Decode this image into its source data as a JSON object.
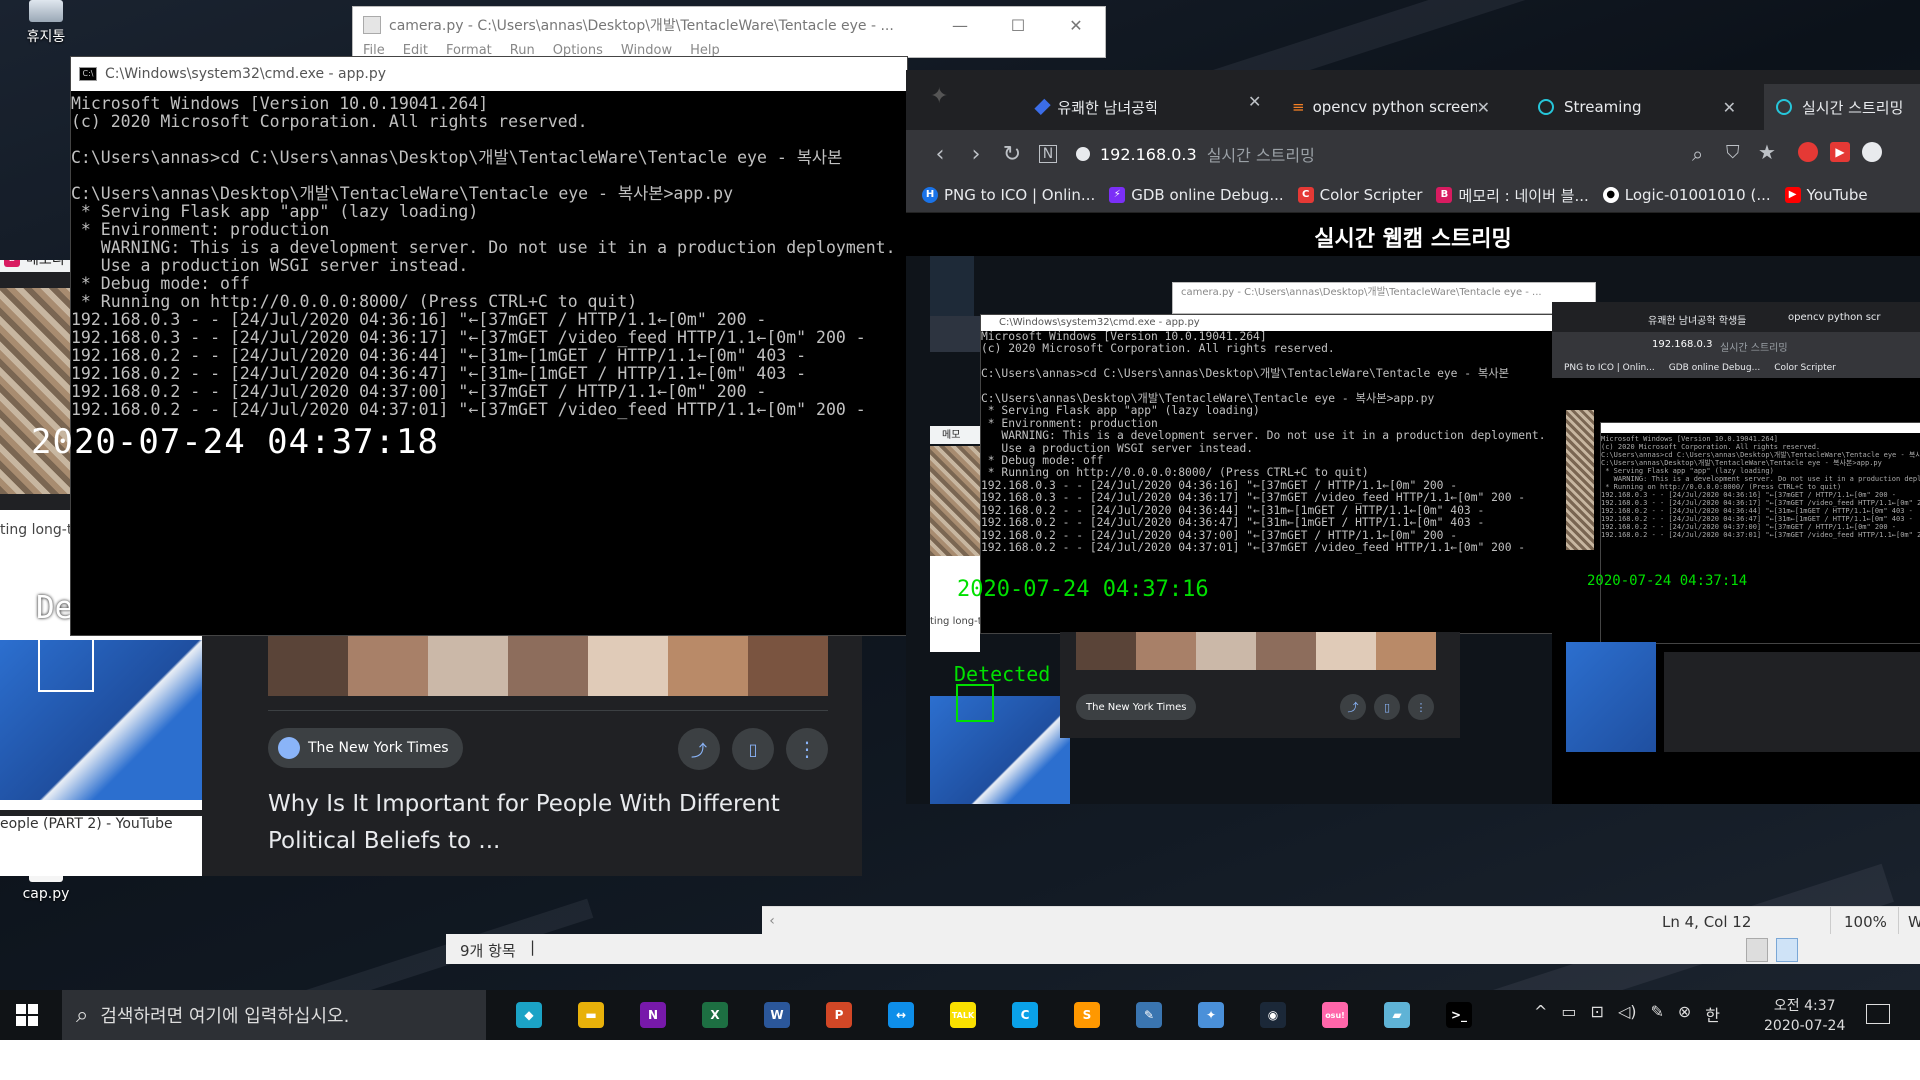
{
  "desktop": {
    "icons": [
      {
        "label": "휴지통"
      },
      {
        "label": "cap.py"
      }
    ]
  },
  "editor": {
    "title": "camera.py - C:\\Users\\annas\\Desktop\\개발\\TentacleWare\\Tentacle eye - ...",
    "menu": [
      "File",
      "Edit",
      "Format",
      "Run",
      "Options",
      "Window",
      "Help"
    ]
  },
  "cmd": {
    "title": "C:\\Windows\\system32\\cmd.exe - app.py",
    "lines": [
      "Microsoft Windows [Version 10.0.19041.264]",
      "(c) 2020 Microsoft Corporation. All rights reserved.",
      "",
      "C:\\Users\\annas>cd C:\\Users\\annas\\Desktop\\개발\\TentacleWare\\Tentacle eye - 복사본",
      "",
      "C:\\Users\\annas\\Desktop\\개발\\TentacleWare\\Tentacle eye - 복사본>app.py",
      " * Serving Flask app \"app\" (lazy loading)",
      " * Environment: production",
      "   WARNING: This is a development server. Do not use it in a production deployment.",
      "   Use a production WSGI server instead.",
      " * Debug mode: off",
      " * Running on http://0.0.0.0:8000/ (Press CTRL+C to quit)",
      "192.168.0.3 - - [24/Jul/2020 04:36:16] \"←[37mGET / HTTP/1.1←[0m\" 200 -",
      "192.168.0.3 - - [24/Jul/2020 04:36:17] \"←[37mGET /video_feed HTTP/1.1←[0m\" 200 -",
      "192.168.0.2 - - [24/Jul/2020 04:36:44] \"←[31m←[1mGET / HTTP/1.1←[0m\" 403 -",
      "192.168.0.2 - - [24/Jul/2020 04:36:47] \"←[31m←[1mGET / HTTP/1.1←[0m\" 403 -",
      "192.168.0.2 - - [24/Jul/2020 04:37:00] \"←[37mGET / HTTP/1.1←[0m\" 200 -",
      "192.168.0.2 - - [24/Jul/2020 04:37:01] \"←[37mGET /video_feed HTTP/1.1←[0m\" 200 -"
    ],
    "overlay_timestamp": "2020-07-24 04:37:18"
  },
  "bgbrowser": {
    "bookmark_label": "메모리",
    "caption_1": "ting long-t",
    "detected_label": "Detected",
    "caption_2": "eople (PART 2) - YouTube",
    "news_source": "The New York Times",
    "headline": "Why Is It Important for People With Different Political Beliefs to ..."
  },
  "chrome": {
    "tabs": [
      {
        "label": "유쾌한 남녀공학 학생들"
      },
      {
        "label": "opencv python screen c"
      },
      {
        "label": "Streaming"
      },
      {
        "label": "실시간 스트리밍"
      }
    ],
    "address": "192.168.0.3",
    "address_title": "실시간 스트리밍",
    "bookmarks": [
      {
        "label": "PNG to ICO | Onlin...",
        "color": "#1a73e8",
        "glyph": "H"
      },
      {
        "label": "GDB online Debug...",
        "color": "#7b2ff7",
        "glyph": "⚡"
      },
      {
        "label": "Color Scripter",
        "color": "#e53935",
        "glyph": "C"
      },
      {
        "label": "메모리 : 네이버 블...",
        "color": "#d81b60",
        "glyph": "B"
      },
      {
        "label": "Logic-01001010 (...",
        "color": "#24292e",
        "glyph": "●"
      },
      {
        "label": "YouTube",
        "color": "#ff0000",
        "glyph": "▶"
      }
    ],
    "page_title": "실시간 웹캠 스트리밍",
    "stream": {
      "timestamp_1": "2020-07-24 04:37:16",
      "detected": "Detected",
      "timestamp_2": "2020-07-24 04:37:14",
      "news_source": "The New York Times",
      "caption": "ting long-t",
      "bookmark": "메모",
      "inner_address": "192.168.0.3",
      "inner_address_title": "실시간 스트리밍",
      "inner_tab_1": "유쾌한 남녀공학 학생들",
      "inner_tab_2": "opencv python scr",
      "inner_bm_1": "PNG to ICO | Onlin...",
      "inner_bm_2": "GDB online Debug...",
      "inner_bm_3": "Color Scripter"
    }
  },
  "editor_status": {
    "position": "Ln 4, Col 12",
    "zoom": "100%",
    "encoding": "Win"
  },
  "explorer": {
    "items_count": "9개 항목"
  },
  "taskbar": {
    "search_placeholder": "검색하려면 여기에 입력하십시오.",
    "apps": [
      {
        "name": "bird-app-icon",
        "color": "#1ba3c6",
        "glyph": "◆"
      },
      {
        "name": "file-explorer-icon",
        "color": "#e8b10a",
        "glyph": "▬"
      },
      {
        "name": "onenote-icon",
        "color": "#7719aa",
        "glyph": "N"
      },
      {
        "name": "excel-icon",
        "color": "#1d6f42",
        "glyph": "X"
      },
      {
        "name": "word-icon",
        "color": "#2b579a",
        "glyph": "W"
      },
      {
        "name": "powerpoint-icon",
        "color": "#d24726",
        "glyph": "P"
      },
      {
        "name": "teamviewer-icon",
        "color": "#0e8ee9",
        "glyph": "↔"
      },
      {
        "name": "kakaotalk-icon",
        "color": "#f9e000",
        "glyph": "TALK"
      },
      {
        "name": "c-app-icon",
        "color": "#0aa1e8",
        "glyph": "C"
      },
      {
        "name": "sublime-icon",
        "color": "#ff9800",
        "glyph": "S"
      },
      {
        "name": "python-idle-icon",
        "color": "#3a75b0",
        "glyph": "✎"
      },
      {
        "name": "network-icon",
        "color": "#4a90d9",
        "glyph": "✦"
      },
      {
        "name": "steam-icon",
        "color": "#1b2838",
        "glyph": "◉"
      },
      {
        "name": "osu-icon",
        "color": "#ff66aa",
        "glyph": "osu!"
      },
      {
        "name": "app-blue-icon",
        "color": "#5fb3d6",
        "glyph": "▰"
      },
      {
        "name": "cmd-icon",
        "color": "#000000",
        "glyph": ">_"
      }
    ],
    "ime": "한",
    "time": "오전 4:37",
    "date": "2020-07-24"
  }
}
